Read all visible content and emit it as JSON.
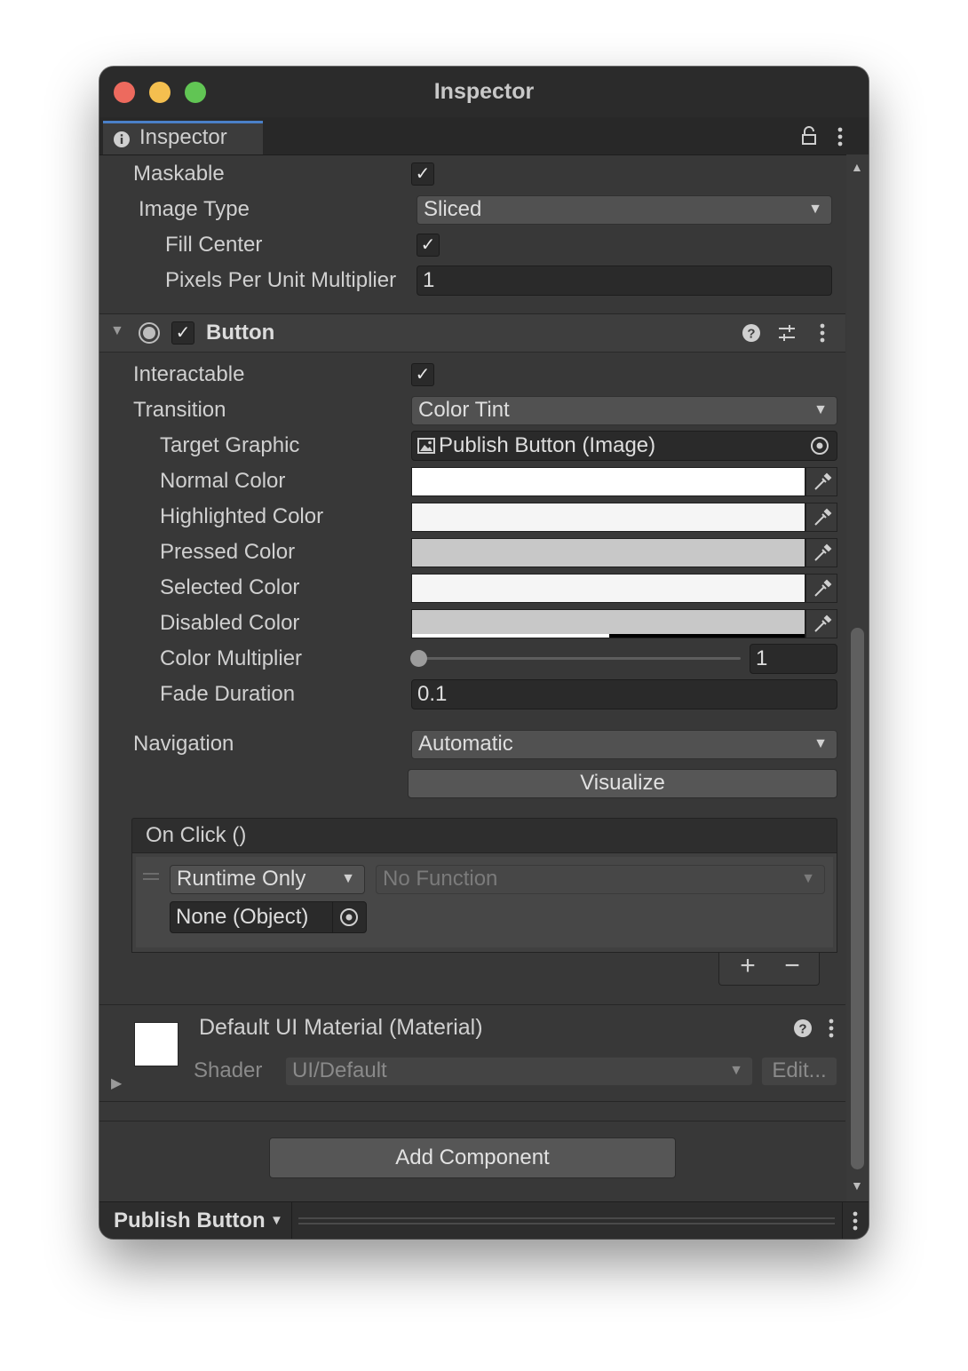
{
  "window": {
    "title": "Inspector"
  },
  "tab": {
    "label": "Inspector"
  },
  "image_component": {
    "maskable_label": "Maskable",
    "maskable_checked": true,
    "image_type_label": "Image Type",
    "image_type_value": "Sliced",
    "fill_center_label": "Fill Center",
    "fill_center_checked": true,
    "ppu_label": "Pixels Per Unit Multiplier",
    "ppu_value": "1"
  },
  "button_component": {
    "title": "Button",
    "enabled": true,
    "interactable_label": "Interactable",
    "interactable_checked": true,
    "transition_label": "Transition",
    "transition_value": "Color Tint",
    "target_graphic_label": "Target Graphic",
    "target_graphic_value": "Publish Button (Image)",
    "normal_color_label": "Normal Color",
    "normal_color": "#ffffff",
    "highlighted_color_label": "Highlighted Color",
    "highlighted_color": "#f5f5f5",
    "pressed_color_label": "Pressed Color",
    "pressed_color": "#c8c8c8",
    "selected_color_label": "Selected Color",
    "selected_color": "#f5f5f5",
    "disabled_color_label": "Disabled Color",
    "disabled_color": "#c8c8c8",
    "color_multiplier_label": "Color Multiplier",
    "color_multiplier_value": "1",
    "fade_duration_label": "Fade Duration",
    "fade_duration_value": "0.1",
    "navigation_label": "Navigation",
    "navigation_value": "Automatic",
    "visualize_label": "Visualize",
    "onclick": {
      "header": "On Click ()",
      "runtime_value": "Runtime Only",
      "function_value": "No Function",
      "object_value": "None (Object)",
      "add_label": "+",
      "remove_label": "−"
    }
  },
  "material": {
    "title": "Default UI Material (Material)",
    "shader_label": "Shader",
    "shader_value": "UI/Default",
    "edit_label": "Edit..."
  },
  "add_component_label": "Add Component",
  "footer": {
    "object_name": "Publish Button"
  },
  "colors": {
    "close": "#ed6a5e",
    "minimize": "#f4bf4f",
    "zoom": "#61c554",
    "tab_accent": "#4a80c8"
  }
}
